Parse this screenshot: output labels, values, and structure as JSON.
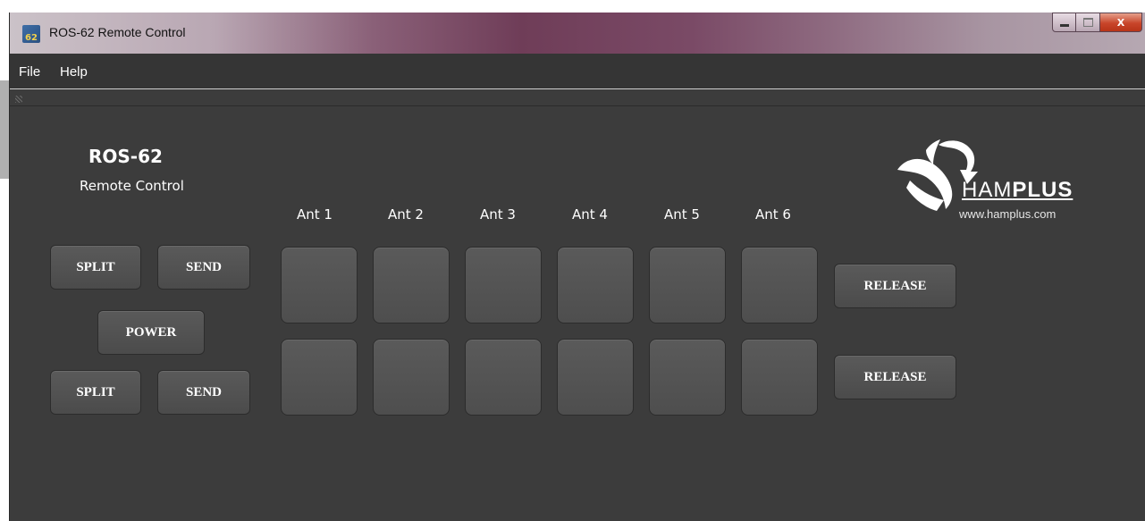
{
  "window": {
    "title": "ROS-62 Remote Control",
    "icon": "ros-62-app-icon",
    "icon_text": "62"
  },
  "window_controls": {
    "minimize": "minimize-icon",
    "maximize": "maximize-icon",
    "close": "X"
  },
  "menu": {
    "items": [
      "File",
      "Help"
    ]
  },
  "device": {
    "name": "ROS-62",
    "subtitle": "Remote Control"
  },
  "antennas": {
    "labels": [
      "Ant 1",
      "Ant 2",
      "Ant 3",
      "Ant 4",
      "Ant 5",
      "Ant 6"
    ]
  },
  "controls": {
    "split_top": "SPLIT",
    "send_top": "SEND",
    "power": "POWER",
    "split_bottom": "SPLIT",
    "send_bottom": "SEND",
    "release_top": "RELEASE",
    "release_bottom": "RELEASE"
  },
  "logo": {
    "brand_light": "HAM",
    "brand_bold": "PLUS",
    "url": "www.hamplus.com"
  },
  "colors": {
    "background": "#3c3c3c",
    "button": "#555555",
    "text": "#ffffff"
  }
}
